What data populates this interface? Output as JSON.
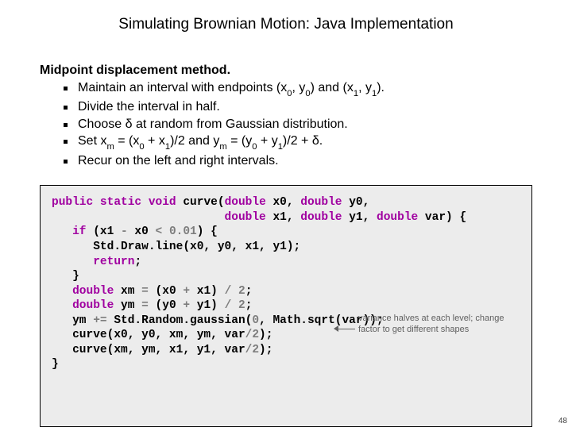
{
  "title": "Simulating Brownian Motion:  Java Implementation",
  "heading": "Midpoint displacement method.",
  "bullets": [
    {
      "pre": "Maintain an interval with endpoints (x",
      "s1": "0",
      "m1": ", y",
      "s2": "0",
      "m2": ") and (x",
      "s3": "1",
      "m3": ", y",
      "s4": "1",
      "post": ")."
    },
    {
      "text": "Divide the interval in half."
    },
    {
      "text": "Choose δ at random from Gaussian distribution."
    },
    {
      "pre": "Set x",
      "s1": "m",
      "m1": " = (x",
      "s2": "0",
      "m2": " + x",
      "s3": "1",
      "m3": ")/2 and y",
      "s4": "m",
      "m4": " = (y",
      "s5": "0",
      "m5": " + y",
      "s6": "1",
      "post": ")/2 + δ."
    },
    {
      "text": "Recur on the left and right intervals."
    }
  ],
  "code": {
    "l1a": "public static void",
    "l1b": " curve(",
    "l1c": "double",
    "l1d": " x0, ",
    "l1e": "double",
    "l1f": " y0,",
    "l2a": "                         ",
    "l2b": "double",
    "l2c": " x1, ",
    "l2d": "double",
    "l2e": " y1, ",
    "l2f": "double",
    "l2g": " var) {",
    "l3a": "   ",
    "l3b": "if",
    "l3c": " (x1 ",
    "l3d": "-",
    "l3e": " x0 ",
    "l3f": "<",
    "l3g": " ",
    "l3h": "0.01",
    "l3i": ") {",
    "l4": "      Std.Draw.line(x0, y0, x1, y1);",
    "l5a": "      ",
    "l5b": "return",
    "l5c": ";",
    "l6": "   }",
    "l7a": "   ",
    "l7b": "double",
    "l7c": " xm ",
    "l7d": "=",
    "l7e": " (x0 ",
    "l7f": "+",
    "l7g": " x1) ",
    "l7h": "/",
    "l7i": " ",
    "l7j": "2",
    "l7k": ";",
    "l8a": "   ",
    "l8b": "double",
    "l8c": " ym ",
    "l8d": "=",
    "l8e": " (y0 ",
    "l8f": "+",
    "l8g": " y1) ",
    "l8h": "/",
    "l8i": " ",
    "l8j": "2",
    "l8k": ";",
    "l9a": "   ym ",
    "l9b": "+=",
    "l9c": " Std.Random.gaussian(",
    "l9d": "0",
    "l9e": ", Math.sqrt(var));",
    "l10a": "   curve(x0, y0, xm, ym, var",
    "l10b": "/",
    "l10c": "2",
    "l10d": ");",
    "l11a": "   curve(xm, ym, x1, y1, var",
    "l11b": "/",
    "l11c": "2",
    "l11d": ");",
    "l12": "}"
  },
  "note_text": "variance halves at each level; change factor to get different shapes",
  "footer": "48"
}
